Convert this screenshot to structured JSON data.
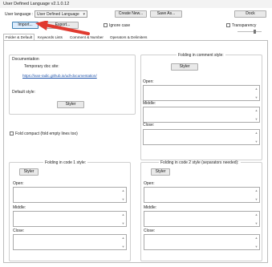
{
  "window": {
    "title": "User Defined Language v2.1.0.12"
  },
  "toolbar": {
    "user_language_label": "User language :",
    "user_language_value": "User Defined Language",
    "create_new": "Create New...",
    "save_as": "Save As...",
    "dock": "Dock",
    "import": "Import...",
    "export": "Export...",
    "ignore_case": "Ignore case",
    "transparency": "Transparency"
  },
  "tabs": [
    "Folder & Default",
    "Keywords Lists",
    "Comment & Number",
    "Operators & Delimiters"
  ],
  "documentation": {
    "title": "Documentation",
    "temp_doc_site": "Temporary doc site:",
    "url": "https://ivan-radic.github.io/udl-documentation/",
    "default_style": "Default style:",
    "styler": "Styler"
  },
  "fold_compact": "Fold compact (fold empty lines too)",
  "folding_comment": {
    "title": "Folding in comment style:",
    "styler": "Styler",
    "open": "Open:",
    "middle": "Middle:",
    "close": "Close:"
  },
  "folding_code1": {
    "title": "Folding in code 1 style:",
    "styler": "Styler",
    "open": "Open:",
    "middle": "Middle:",
    "close": "Close:"
  },
  "folding_code2": {
    "title": "Folding in code 2 style (separators needed):",
    "styler": "Styler",
    "open": "Open:",
    "middle": "Middle:",
    "close": "Close:"
  },
  "colors": {
    "annotation_arrow": "#e03a2f",
    "link": "#1a4fa8",
    "highlight": "#3c7fb1"
  }
}
